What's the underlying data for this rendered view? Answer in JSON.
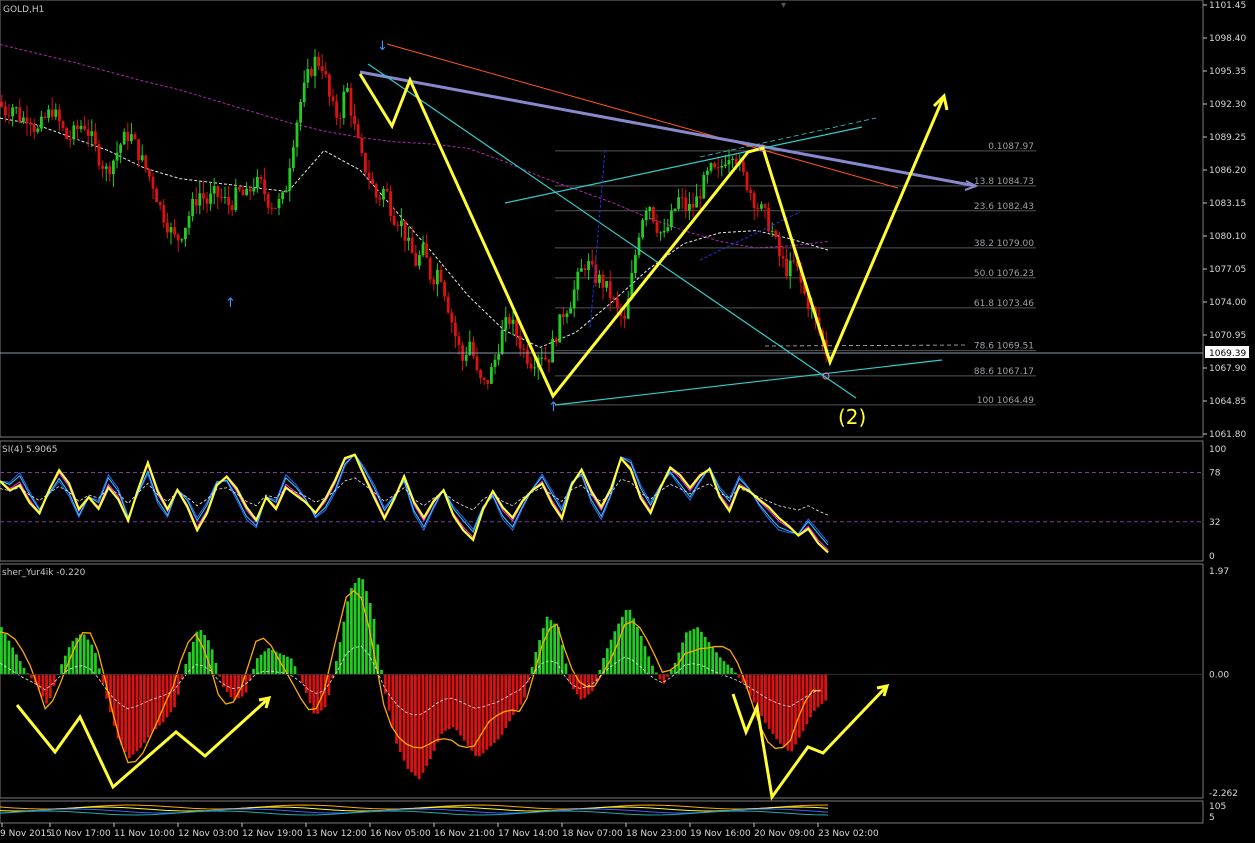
{
  "chart_data": [
    {
      "panel": "price",
      "type": "candlestick",
      "title": "GOLD,H1",
      "ylim": [
        1061.8,
        1101.45
      ],
      "y_ticks": [
        "1101.45",
        "1098.40",
        "1095.35",
        "1092.30",
        "1089.25",
        "1086.20",
        "1083.15",
        "1080.10",
        "1077.05",
        "1074.00",
        "1070.95",
        "1067.90",
        "1064.85",
        "1061.80"
      ],
      "current_price": "1069.39",
      "close_path": [
        1092.5,
        1091.6,
        1092.2,
        1090.8,
        1091.4,
        1089.6,
        1090.9,
        1091.8,
        1090.4,
        1088.9,
        1089.8,
        1090.6,
        1089.2,
        1087.4,
        1086.1,
        1087.3,
        1088.9,
        1089.6,
        1088.0,
        1086.4,
        1084.9,
        1082.6,
        1081.0,
        1079.6,
        1080.8,
        1082.7,
        1084.1,
        1083.2,
        1084.0,
        1083.5,
        1082.9,
        1084.2,
        1083.6,
        1085.0,
        1084.8,
        1083.2,
        1082.9,
        1083.7,
        1088.5,
        1092.3,
        1094.8,
        1096.4,
        1095.8,
        1092.1,
        1091.0,
        1094.1,
        1090.2,
        1087.1,
        1085.5,
        1083.4,
        1084.6,
        1082.0,
        1081.5,
        1079.2,
        1077.6,
        1078.8,
        1076.0,
        1077.2,
        1074.1,
        1071.1,
        1068.6,
        1070.5,
        1066.8,
        1066.3,
        1068.1,
        1070.9,
        1072.5,
        1071.0,
        1069.3,
        1068.4,
        1069.5,
        1068.6,
        1070.8,
        1073.0,
        1074.1,
        1076.3,
        1077.8,
        1076.4,
        1075.9,
        1074.8,
        1073.2,
        1072.0,
        1076.8,
        1081.4,
        1083.5,
        1081.2,
        1079.9,
        1081.8,
        1083.6,
        1082.5,
        1083.0,
        1084.7,
        1086.2,
        1085.8,
        1087.4,
        1088.1,
        1086.0,
        1084.6,
        1083.0,
        1082.1,
        1080.5,
        1078.1,
        1076.9,
        1077.6,
        1075.0,
        1073.4,
        1071.5,
        1069.39
      ],
      "moving_averages": [
        {
          "color": "#b026b0",
          "style": "dashed",
          "values": [
            1097.8,
            1097.0,
            1096.2,
            1095.3,
            1094.4,
            1093.6,
            1092.6,
            1091.6,
            1090.6,
            1089.8,
            1089.2,
            1088.8,
            1088.6,
            1088.2,
            1087.0,
            1085.6,
            1084.4,
            1083.2,
            1081.8,
            1080.6,
            1079.6,
            1079.0,
            1079.2,
            1079.6
          ]
        },
        {
          "color": "#e8e8e8",
          "style": "dashed",
          "values": [
            1091.0,
            1090.4,
            1089.2,
            1088.0,
            1086.4,
            1085.4,
            1085.0,
            1084.6,
            1084.2,
            1088.0,
            1086.2,
            1082.4,
            1078.6,
            1074.6,
            1071.4,
            1069.8,
            1071.2,
            1074.0,
            1077.0,
            1079.4,
            1080.4,
            1080.6,
            1079.8,
            1078.8
          ]
        }
      ],
      "fibonacci_levels": [
        {
          "label": "0.1087.97",
          "value": 1087.97
        },
        {
          "label": "13.8 1084.73",
          "value": 1084.73
        },
        {
          "label": "23.6 1082.43",
          "value": 1082.43
        },
        {
          "label": "38.2 1079.00",
          "value": 1079.0
        },
        {
          "label": "50.0 1076.23",
          "value": 1076.23
        },
        {
          "label": "61.8 1073.46",
          "value": 1073.46
        },
        {
          "label": "78.6 1069.51",
          "value": 1069.51
        },
        {
          "label": "88.6 1067.17",
          "value": 1067.17
        },
        {
          "label": "100 1064.49",
          "value": 1064.49
        }
      ],
      "annotation": "(2)",
      "annotation_color": "#ffff33"
    },
    {
      "panel": "rsi",
      "type": "line",
      "title": "SI(4) 5.9065",
      "ylim": [
        0,
        100
      ],
      "y_ticks": [
        "100",
        "78",
        "32",
        "0"
      ],
      "levels": [
        78,
        32
      ],
      "values": [
        70,
        65,
        72,
        55,
        42,
        60,
        75,
        62,
        40,
        55,
        48,
        70,
        58,
        35,
        60,
        82,
        55,
        40,
        62,
        50,
        30,
        45,
        68,
        72,
        58,
        40,
        30,
        55,
        48,
        70,
        62,
        52,
        38,
        48,
        65,
        88,
        95,
        78,
        60,
        40,
        55,
        72,
        45,
        30,
        48,
        62,
        42,
        30,
        20,
        45,
        58,
        40,
        30,
        48,
        62,
        72,
        55,
        40,
        68,
        78,
        55,
        40,
        60,
        92,
        85,
        60,
        45,
        65,
        80,
        70,
        58,
        72,
        82,
        60,
        48,
        70,
        62,
        50,
        40,
        30,
        25,
        20,
        30,
        18,
        8
      ],
      "series_colors": [
        "#ffff33",
        "#ff33ff",
        "#33ccff",
        "#3366ff"
      ]
    },
    {
      "panel": "fisher",
      "type": "histogram",
      "title": "sher_Yur4ik -0.220",
      "ylim": [
        -2.262,
        1.97
      ],
      "y_ticks": [
        "1.97",
        "0.00",
        "-2.262"
      ],
      "positive_color": "#22cc22",
      "negative_color": "#dd1111",
      "line_color": "#ffaa00",
      "values": [
        0.9,
        0.5,
        0.1,
        -0.2,
        -0.6,
        0.1,
        0.6,
        0.8,
        0.5,
        -0.4,
        -1.2,
        -1.6,
        -1.4,
        -1.1,
        -0.9,
        -0.6,
        0.3,
        0.9,
        0.6,
        -0.2,
        -0.5,
        -0.4,
        0.3,
        0.5,
        0.4,
        0.3,
        -0.2,
        -0.8,
        -0.6,
        0.4,
        1.6,
        1.9,
        1.2,
        -0.3,
        -1.3,
        -1.8,
        -2.0,
        -1.6,
        -1.1,
        -1.0,
        -1.3,
        -1.6,
        -1.4,
        -1.2,
        -0.8,
        -0.5,
        0.4,
        1.1,
        0.9,
        -0.2,
        -0.5,
        -0.3,
        0.4,
        0.9,
        1.3,
        0.8,
        0.2,
        -0.2,
        0.2,
        0.8,
        0.9,
        0.6,
        0.3,
        0.1,
        -0.2,
        -0.6,
        -1.0,
        -1.3,
        -1.5,
        -1.1,
        -0.7,
        -0.5
      ]
    },
    {
      "panel": "bottom",
      "type": "line",
      "y_ticks": [
        "105",
        "5"
      ]
    }
  ],
  "x_axis_labels": [
    "9 Nov 2015",
    "10 Nov 17:00",
    "11 Nov 10:00",
    "12 Nov 03:00",
    "12 Nov 19:00",
    "13 Nov 12:00",
    "16 Nov 05:00",
    "16 Nov 21:00",
    "17 Nov 14:00",
    "18 Nov 07:00",
    "18 Nov 23:00",
    "19 Nov 16:00",
    "20 Nov 09:00",
    "23 Nov 02:00"
  ]
}
